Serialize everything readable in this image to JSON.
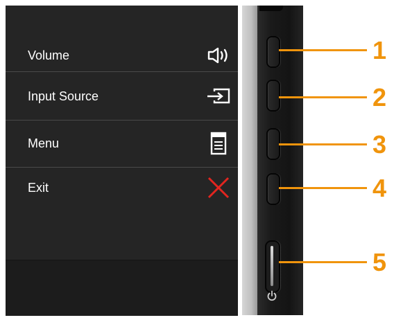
{
  "osd_menu": {
    "items": [
      {
        "label": "Volume",
        "icon": "speaker-icon"
      },
      {
        "label": "Input Source",
        "icon": "input-source-icon"
      },
      {
        "label": "Menu",
        "icon": "menu-icon"
      },
      {
        "label": "Exit",
        "icon": "close-icon"
      }
    ]
  },
  "callouts": [
    "1",
    "2",
    "3",
    "4",
    "5"
  ],
  "colors": {
    "osd_background": "#252525",
    "callout": "#f0940c",
    "exit_icon": "#e3251f",
    "text": "#ffffff"
  }
}
